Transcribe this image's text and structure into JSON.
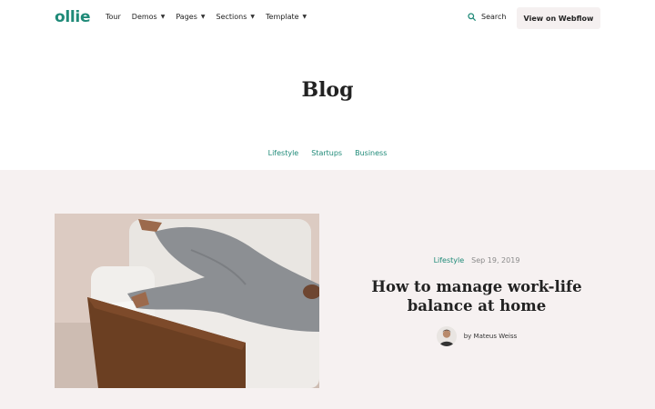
{
  "brand": {
    "logo": "ollie",
    "accent": "#1f8a78"
  },
  "nav": {
    "items": [
      {
        "label": "Tour",
        "dropdown": false
      },
      {
        "label": "Demos",
        "dropdown": true
      },
      {
        "label": "Pages",
        "dropdown": true
      },
      {
        "label": "Sections",
        "dropdown": true
      },
      {
        "label": "Template",
        "dropdown": true
      }
    ],
    "caret": "▼",
    "search_label": "Search",
    "cta_label": "View on Webflow"
  },
  "hero": {
    "title": "Blog",
    "categories": [
      "Lifestyle",
      "Startups",
      "Business"
    ]
  },
  "featured_post": {
    "category": "Lifestyle",
    "date": "Sep 19, 2019",
    "title": "How to manage work-life balance at home",
    "author": "by Mateus Weiss",
    "background": "#f6f1f1"
  }
}
